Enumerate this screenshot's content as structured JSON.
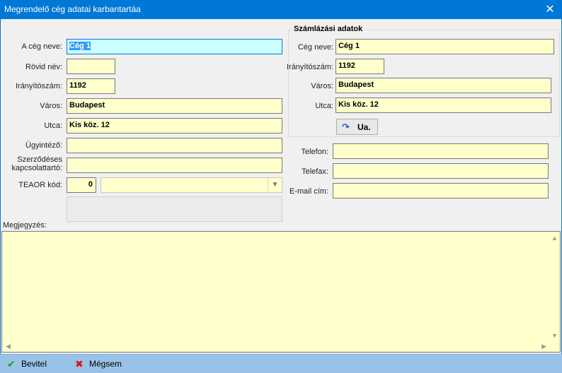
{
  "window": {
    "title": "Megrendelő cég adatai karbantartáa"
  },
  "form": {
    "company_name_label": "A cég neve:",
    "company_name_value": "Cég 1",
    "short_name_label": "Rövid név:",
    "short_name_value": "",
    "zip_label": "Irányítószám:",
    "zip_value": "1192",
    "city_label": "Város:",
    "city_value": "Budapest",
    "street_label": "Utca:",
    "street_value": "Kis köz. 12",
    "agent_label": "Ügyintéző:",
    "agent_value": "",
    "contract_contact_label": "Szerződéses kapcsolattartó:",
    "contract_contact_value": "",
    "teaor_label": "TEAOR kód:",
    "teaor_value": "0",
    "teaor_select_value": ""
  },
  "billing": {
    "group_title": "Számlázási adatok",
    "company_name_label": "Cég neve:",
    "company_name_value": "Cég 1",
    "zip_label": "Irányítószám:",
    "zip_value": "1192",
    "city_label": "Város:",
    "city_value": "Budapest",
    "street_label": "Utca:",
    "street_value": "Kis köz. 12",
    "same_button_label": "Ua."
  },
  "contact": {
    "phone_label": "Telefon:",
    "phone_value": "",
    "fax_label": "Telefax:",
    "fax_value": "",
    "email_label": "E-mail cím:",
    "email_value": ""
  },
  "notes": {
    "label": "Megjegyzés:",
    "value": ""
  },
  "footer": {
    "ok_label": "Bevitel",
    "cancel_label": "Mégsem"
  },
  "icons": {
    "close": "close-icon",
    "same_as": "redo-arrow-icon",
    "ok": "check-icon",
    "cancel": "x-icon"
  },
  "colors": {
    "titlebar": "#0078d7",
    "field_bg": "#ffffcc",
    "active_field_bg": "#ccffff",
    "footer_bg": "#99c2e8"
  }
}
